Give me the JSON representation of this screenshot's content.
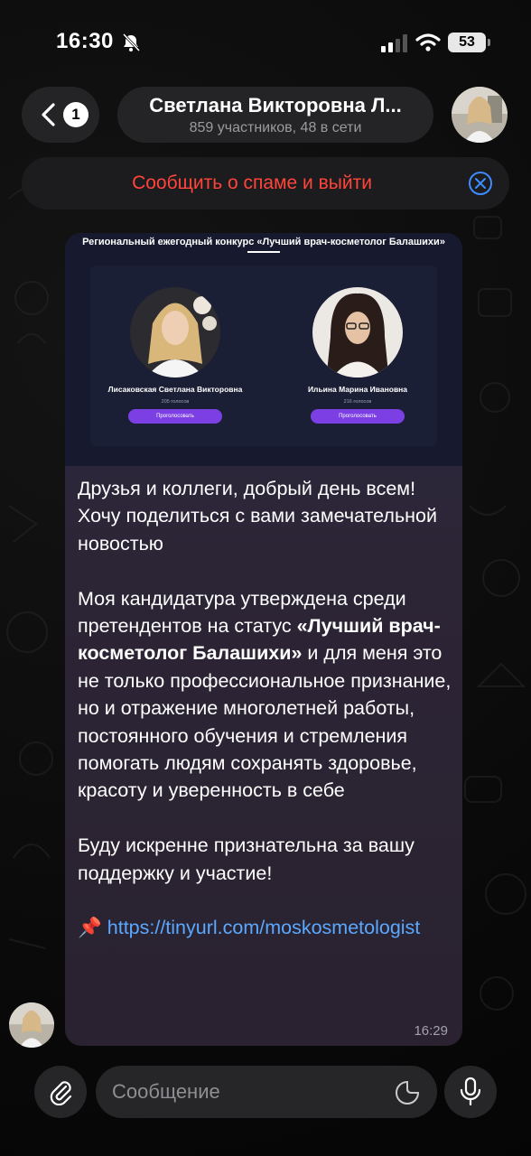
{
  "status_bar": {
    "time": "16:30",
    "battery": "53"
  },
  "header": {
    "back_count": "1",
    "title": "Светлана Викторовна Л...",
    "subtitle": "859 участников, 48 в сети"
  },
  "spam_banner": {
    "label": "Сообщить о спаме и выйти"
  },
  "message": {
    "media": {
      "title": "Региональный ежегодный конкурс «Лучший врач-косметолог Балашихи»",
      "candidates": [
        {
          "name": "Лисаковская Светлана Викторовна",
          "votes": "205 голосов",
          "button": "Проголосовать"
        },
        {
          "name": "Ильина Марина Ивановна",
          "votes": "216 голосов",
          "button": "Проголосовать"
        }
      ]
    },
    "paragraph1": "Друзья и коллеги, добрый день всем! Хочу поделиться с вами замечательной новостью",
    "paragraph2_start": "Моя кандидатура утверждена среди претендентов на статус ",
    "paragraph2_bold": "«Лучший врач-косметолог Балашихи»",
    "paragraph2_end": " и для меня это не только профессиональное признание, но и отражение многолетней работы, постоянного обучения и стремления помогать людям сохранять здоровье, красоту и уверенность в себе",
    "paragraph3": "Буду искренне признательна за вашу поддержку и участие!",
    "pin_emoji": "📌",
    "link": "https://tinyurl.com/moskosmetologist",
    "time": "16:29"
  },
  "composer": {
    "placeholder": "Сообщение"
  },
  "colors": {
    "accent_link": "#5aa8ff",
    "spam_red": "#ff453a",
    "vote_purple": "#7b3fe4"
  }
}
